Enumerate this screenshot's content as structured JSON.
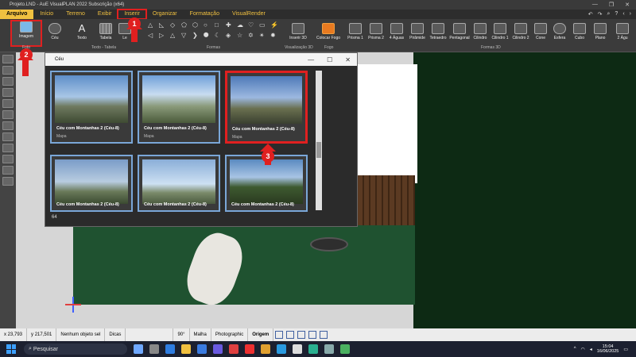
{
  "window": {
    "title": "Projeto.LND - AuE VisualPLAN 2022 Subscrição (x64)",
    "controls": [
      "—",
      "❐",
      "✕"
    ]
  },
  "menu": {
    "items": [
      "Arquivo",
      "Início",
      "Terreno",
      "Exibir",
      "Inserir",
      "Organizar",
      "Formatação",
      "VisualRender"
    ],
    "right_icons": [
      "↶",
      "↷",
      "⌕",
      "?",
      "‹",
      "›"
    ]
  },
  "ribbon": {
    "buttons": {
      "imagem": "Imagem",
      "ceu": "Céu",
      "texto": "Texto",
      "tabela": "Tabela",
      "legenda": "Le",
      "inserir3d": "Inserir 3D",
      "colocarfogo": "Colocar Fogo"
    },
    "groups": {
      "foto": "Foto",
      "textotabela": "Texto - Tabela",
      "formas": "Formas",
      "vis3d": "Visualização 3D",
      "fogo": "Fogo",
      "formas3d": "Formas 3D"
    },
    "shapes3d": [
      "Prisma 1",
      "Prisma 2",
      "4 Águas",
      "Pirâmide",
      "Tetraedro",
      "Pentagonal",
      "Cilindro",
      "Cilindro 1",
      "Cilindro 2",
      "Cone",
      "Esfera",
      "Cubo",
      "Plano",
      "2 Águ"
    ]
  },
  "dialog": {
    "title": "Céu",
    "cards": [
      {
        "name": "Céu com Montanhas 2 (Céu-8)",
        "sub": "Mapa"
      },
      {
        "name": "Céu com Montanhas 2 (Céu-8)",
        "sub": "Mapa"
      },
      {
        "name": "Céu com Montanhas 2 (Céu-8)",
        "sub": "Mapa"
      },
      {
        "name": "Céu com Montanhas 2 (Céu-8)",
        "sub": ""
      },
      {
        "name": "Céu com Montanhas 2 (Céu-8)",
        "sub": ""
      },
      {
        "name": "Céu com Montanhas 2 (Céu-8)",
        "sub": ""
      }
    ],
    "count": "64"
  },
  "annotations": {
    "b1": "1",
    "b2": "2",
    "b3": "3"
  },
  "status": {
    "x": "x 23,793",
    "y": "y 217,501",
    "sel": "Nenhum objeto sel",
    "dicas": "Dicas",
    "angle": "90°",
    "malha": "Malha",
    "photo": "Photographic",
    "origem": "Origem"
  },
  "taskbar": {
    "search": "Pesquisar",
    "time": "15:04",
    "date": "16/06/2025"
  }
}
